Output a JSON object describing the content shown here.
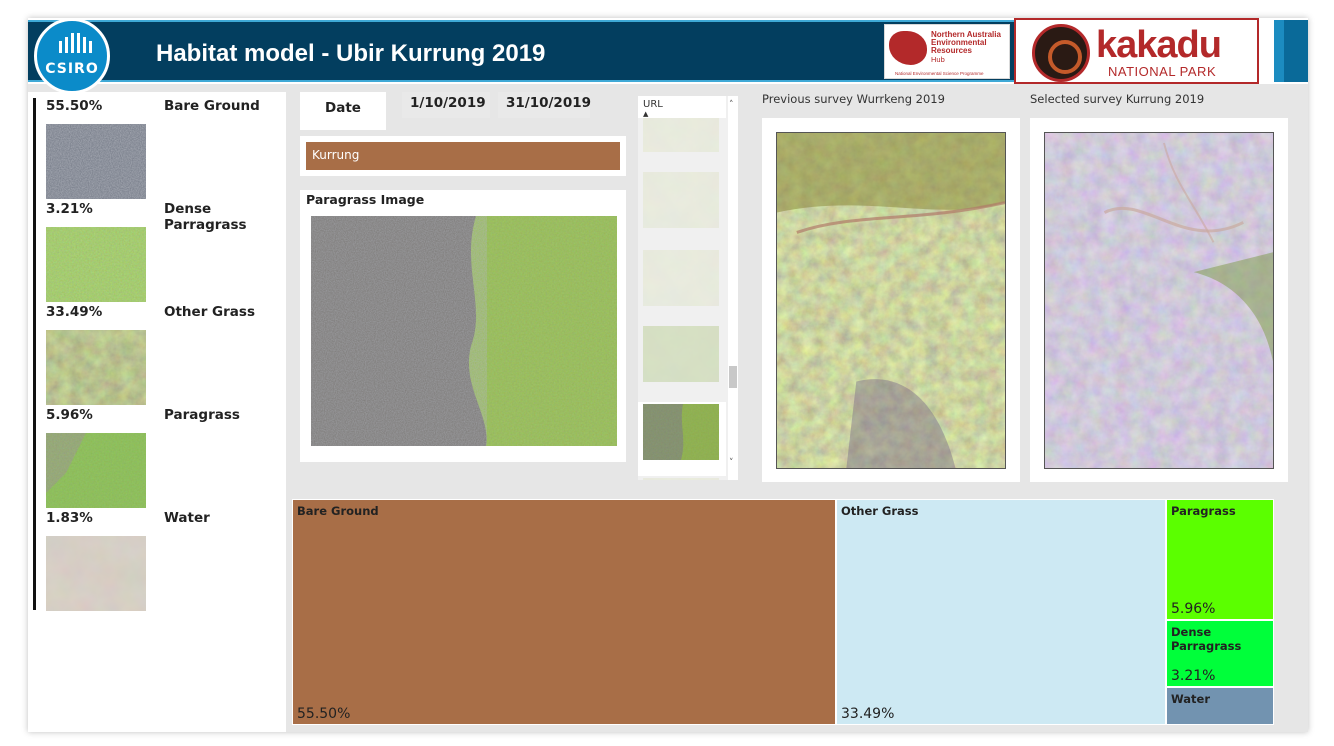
{
  "header": {
    "title": "Habitat model - Ubir Kurrung 2019",
    "csiro_logo_text": "CSIRO",
    "naerh_logo_lines": [
      "Northern Australia",
      "Environmental",
      "Resources"
    ],
    "naerh_logo_hub": "Hub",
    "naerh_logo_program": "National Environmental Science Programme",
    "kakadu_logo_name": "kakadu",
    "kakadu_logo_sub": "NATIONAL PARK",
    "brand_color": "#033e5f",
    "accent_color": "#b3292a"
  },
  "legend": [
    {
      "pct": "55.50%",
      "name": "Bare Ground",
      "thumb_icon": "bare-ground-photo"
    },
    {
      "pct": "3.21%",
      "name": "Dense Parragrass",
      "thumb_icon": "dense-paragrass-photo"
    },
    {
      "pct": "33.49%",
      "name": "Other Grass",
      "thumb_icon": "other-grass-photo"
    },
    {
      "pct": "5.96%",
      "name": "Paragrass",
      "thumb_icon": "paragrass-photo"
    },
    {
      "pct": "1.83%",
      "name": "Water",
      "thumb_icon": "water-photo"
    }
  ],
  "date_slicer": {
    "label": "Date",
    "start": "1/10/2019",
    "end": "31/10/2019"
  },
  "site_filter": {
    "value": "Kurrung",
    "color": "#a86e47"
  },
  "paragrass_image": {
    "title": "Paragrass Image"
  },
  "url_list": {
    "header": "URL",
    "sort_icon": "sort-ascending-icon",
    "selected_index": 4
  },
  "surveys": {
    "previous_caption": "Previous survey Wurrkeng 2019",
    "selected_caption": "Selected survey Kurrung 2019"
  },
  "treemap": [
    {
      "name": "Bare Ground",
      "value": "55.50%",
      "color": "#a86e47"
    },
    {
      "name": "Other Grass",
      "value": "33.49%",
      "color": "#cde9f3"
    },
    {
      "name": "Paragrass",
      "value": "5.96%",
      "color": "#5bff00"
    },
    {
      "name": "Dense Parragrass",
      "value": "3.21%",
      "color": "#00ff3a"
    },
    {
      "name": "Water",
      "value": "",
      "color": "#7293b0"
    }
  ]
}
